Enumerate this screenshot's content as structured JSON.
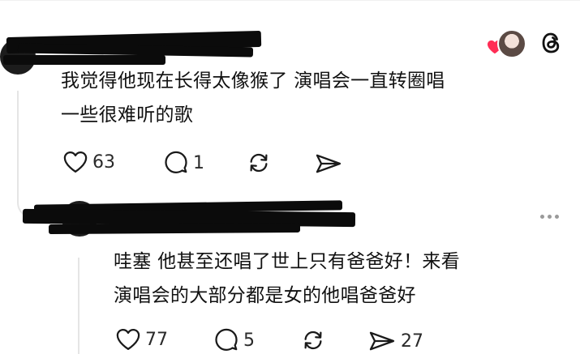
{
  "comment1": {
    "line1": "我觉得他现在长得太像猴了 演唱会一直转圈唱",
    "line2": "一些很难听的歌",
    "likes": "63",
    "replies": "1",
    "reposts": "",
    "shares": ""
  },
  "comment2": {
    "line1": "哇塞 他甚至还唱了世上只有爸爸好！来看",
    "line2": "演唱会的大部分都是女的他唱爸爸好",
    "likes": "77",
    "replies": "5",
    "reposts": "",
    "shares": "27"
  },
  "icons": {
    "like": "heart-outline-icon",
    "reply": "speech-bubble-icon",
    "repost": "repost-arrows-icon",
    "share": "send-arrow-icon",
    "reaction": "red-heart-icon",
    "app_logo": "threads-logo-icon",
    "more": "more-dots-icon"
  },
  "colors": {
    "reaction_heart": "#ff2d55",
    "text": "#111111",
    "icon": "#1a1a1a",
    "thread_line": "#e5e5e5"
  }
}
